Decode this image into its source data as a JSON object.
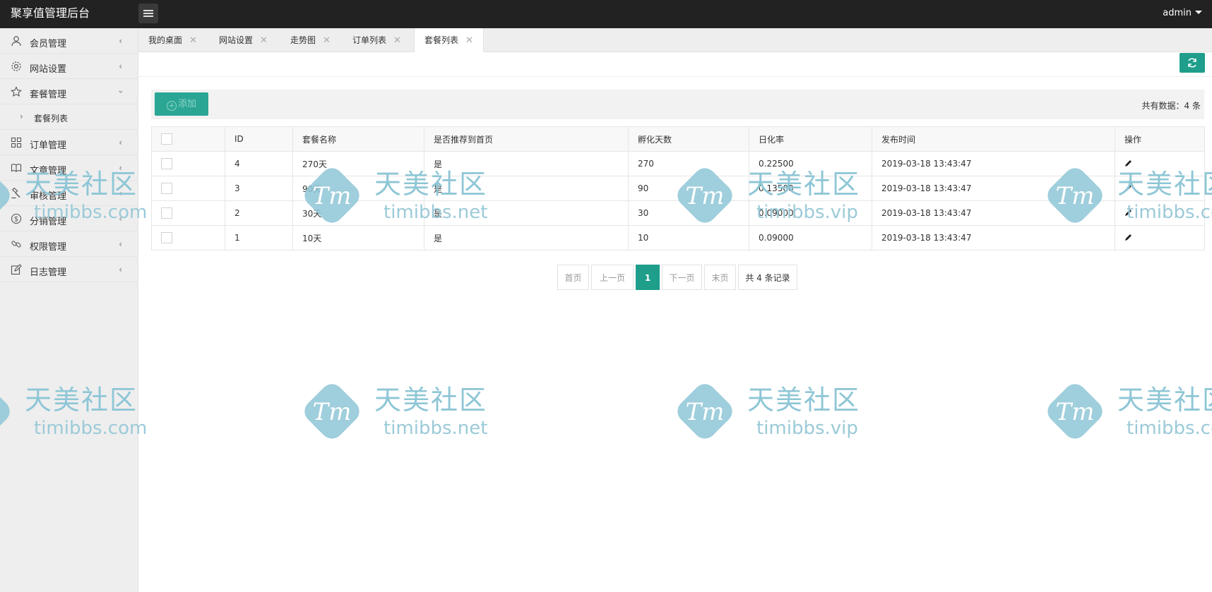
{
  "header": {
    "title": "聚享值管理后台",
    "user": "admin"
  },
  "sidebar": {
    "items": [
      {
        "label": "会员管理",
        "icon": "user-icon",
        "expanded": false
      },
      {
        "label": "网站设置",
        "icon": "gear-icon",
        "expanded": false
      },
      {
        "label": "套餐管理",
        "icon": "star-icon",
        "expanded": true,
        "children": [
          {
            "label": "套餐列表"
          }
        ]
      },
      {
        "label": "订单管理",
        "icon": "grid-icon",
        "expanded": false
      },
      {
        "label": "文章管理",
        "icon": "book-icon",
        "expanded": false
      },
      {
        "label": "审核管理",
        "icon": "gavel-icon",
        "expanded": false
      },
      {
        "label": "分销管理",
        "icon": "dollar-icon",
        "expanded": false
      },
      {
        "label": "权限管理",
        "icon": "link-icon",
        "expanded": false
      },
      {
        "label": "日志管理",
        "icon": "edit-icon",
        "expanded": false
      }
    ]
  },
  "tabs": [
    {
      "label": "我的桌面"
    },
    {
      "label": "网站设置"
    },
    {
      "label": "走势图"
    },
    {
      "label": "订单列表"
    },
    {
      "label": "套餐列表",
      "active": true
    }
  ],
  "toolbar": {
    "add_label": "添加",
    "total_label": "共有数据：4 条"
  },
  "table": {
    "columns": [
      "ID",
      "套餐名称",
      "是否推荐到首页",
      "孵化天数",
      "日化率",
      "发布时间",
      "操作"
    ],
    "rows": [
      {
        "id": "4",
        "name": "270天",
        "recommend": "是",
        "days": "270",
        "rate": "0.22500",
        "time": "2019-03-18 13:43:47"
      },
      {
        "id": "3",
        "name": "90天",
        "recommend": "是",
        "days": "90",
        "rate": "0.13500",
        "time": "2019-03-18 13:43:47"
      },
      {
        "id": "2",
        "name": "30天",
        "recommend": "是",
        "days": "30",
        "rate": "0.09000",
        "time": "2019-03-18 13:43:47"
      },
      {
        "id": "1",
        "name": "10天",
        "recommend": "是",
        "days": "10",
        "rate": "0.09000",
        "time": "2019-03-18 13:43:47"
      }
    ]
  },
  "pagination": {
    "first": "首页",
    "prev": "上一页",
    "current": "1",
    "next": "下一页",
    "last": "末页",
    "info": "共 4 条记录"
  },
  "watermark": {
    "logo_text": "Tm",
    "name": "天美社区",
    "domain_com": "timibbs.com",
    "domain_net": "timibbs.net",
    "domain_vip": "timibbs.vip"
  },
  "colors": {
    "accent": "#1e9e8b",
    "topbar": "#222222",
    "sidebar": "#eeeeee",
    "watermark": "#8ec6d6"
  }
}
